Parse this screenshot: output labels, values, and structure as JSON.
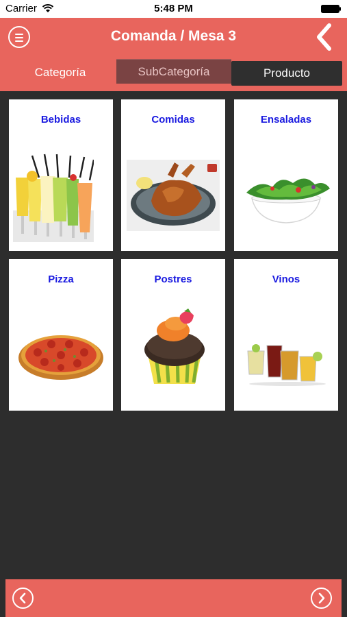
{
  "status_bar": {
    "carrier": "Carrier",
    "time": "5:48 PM",
    "icons": [
      "wifi-icon",
      "battery-icon"
    ]
  },
  "header": {
    "title": "Comanda / Mesa 3",
    "menu_icon": "menu-icon",
    "back_icon": "chevron-left-icon",
    "color": "#e8655d"
  },
  "tabs": [
    {
      "label": "Categoría"
    },
    {
      "label": "SubCategoría"
    },
    {
      "label": "Producto"
    }
  ],
  "categories": [
    {
      "label": "Bebidas",
      "image": "drinks-image"
    },
    {
      "label": "Comidas",
      "image": "roast-chicken-image"
    },
    {
      "label": "Ensaladas",
      "image": "salad-bowl-image"
    },
    {
      "label": "Pizza",
      "image": "pizza-image"
    },
    {
      "label": "Postres",
      "image": "cupcake-image"
    },
    {
      "label": "Vinos",
      "image": "cocktail-glasses-image"
    }
  ],
  "footer": {
    "prev_icon": "chevron-left-circle-icon",
    "next_icon": "chevron-right-circle-icon"
  },
  "colors": {
    "accent": "#e8655d",
    "background": "#2d2d2d",
    "label": "#1a1ae0"
  }
}
